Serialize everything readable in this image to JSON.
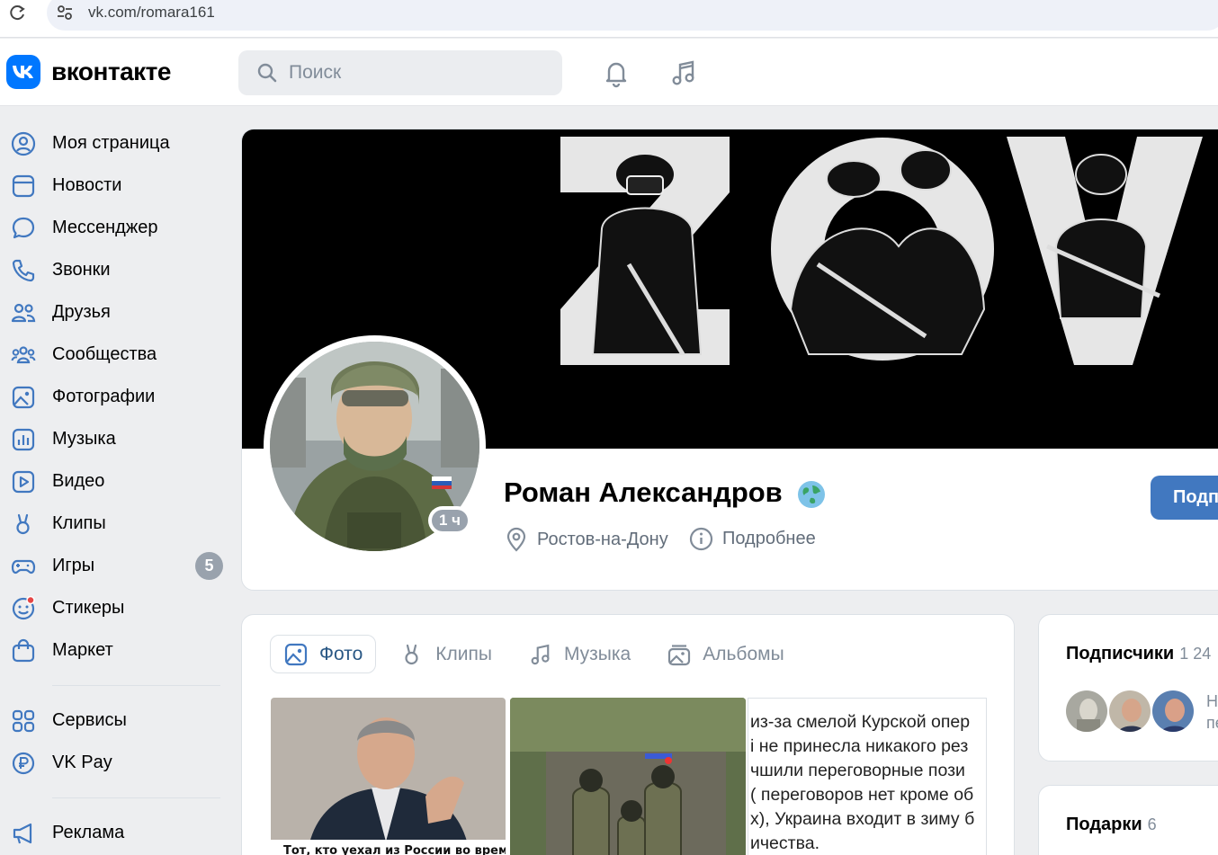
{
  "browser": {
    "url": "vk.com/romara161"
  },
  "header": {
    "logo_text": "вконтакте",
    "search_placeholder": "Поиск"
  },
  "nav": {
    "items": [
      {
        "label": "Моя страница",
        "icon": "user-circle-icon"
      },
      {
        "label": "Новости",
        "icon": "newsfeed-icon"
      },
      {
        "label": "Мессенджер",
        "icon": "message-icon"
      },
      {
        "label": "Звонки",
        "icon": "phone-icon"
      },
      {
        "label": "Друзья",
        "icon": "friends-icon"
      },
      {
        "label": "Сообщества",
        "icon": "groups-icon"
      },
      {
        "label": "Фотографии",
        "icon": "picture-icon"
      },
      {
        "label": "Музыка",
        "icon": "music-icon"
      },
      {
        "label": "Видео",
        "icon": "video-icon"
      },
      {
        "label": "Клипы",
        "icon": "clips-icon"
      },
      {
        "label": "Игры",
        "icon": "gamepad-icon",
        "badge": "5"
      },
      {
        "label": "Стикеры",
        "icon": "smile-icon"
      },
      {
        "label": "Маркет",
        "icon": "market-icon"
      }
    ],
    "services": [
      {
        "label": "Сервисы",
        "icon": "services-grid-icon"
      },
      {
        "label": "VK Pay",
        "icon": "ruble-icon"
      }
    ],
    "ads": [
      {
        "label": "Реклама",
        "icon": "megaphone-icon"
      }
    ]
  },
  "profile": {
    "name": "Роман Александров",
    "last_seen": "1 ч",
    "city": "Ростов-на-Дону",
    "more_label": "Подробнее",
    "subscribe_label": "Подп",
    "cover_letters": [
      "Z",
      "O",
      "V"
    ]
  },
  "media": {
    "tabs": [
      "Фото",
      "Клипы",
      "Музыка",
      "Альбомы"
    ],
    "photo_caption": "Тот, кто уехал из России во время",
    "text_post_lines": [
      "из-за смелой Курской опер",
      "і не принесла никакого рез",
      "чшили переговорные пози",
      "( переговоров нет кроме об",
      "х), Украина входит в зиму б",
      "ичества."
    ]
  },
  "followers": {
    "title": "Подписчики",
    "count": "1 24",
    "name_fragments": [
      "Н",
      "пе"
    ]
  },
  "gifts": {
    "title": "Подарки",
    "count": "6"
  },
  "colors": {
    "accent": "#0077ff",
    "button": "#4178c0",
    "badge": "#99a2ad"
  }
}
